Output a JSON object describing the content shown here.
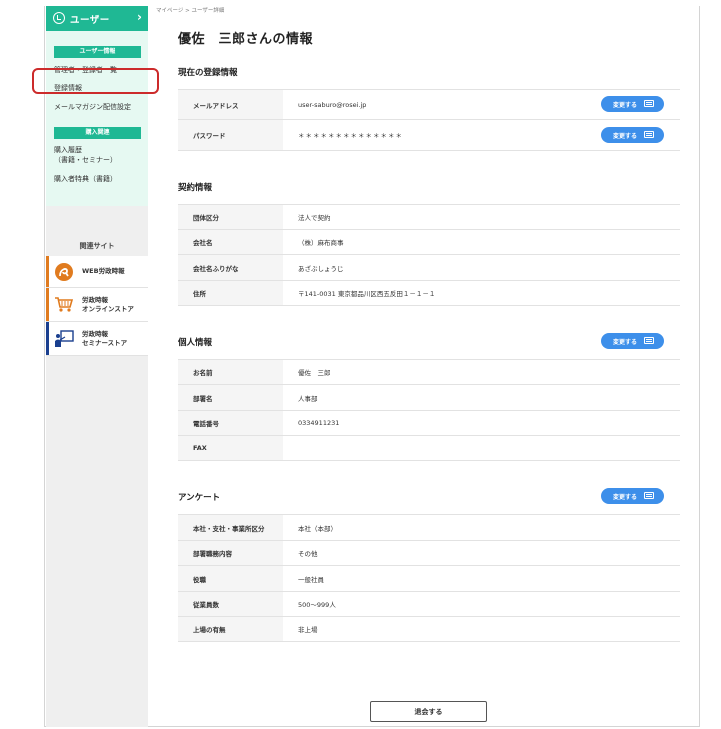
{
  "breadcrumb": "マイページ > ユーザー詳細",
  "page_title": "優佐　三郎さんの情報",
  "sidebar": {
    "header_label": "ユーザー",
    "section_user": "ユーザー情報",
    "links_user": [
      "管理者・登録者一覧",
      "登録情報",
      "メールマガジン配信設定"
    ],
    "section_purchase": "購入関連",
    "purchase_history_line1": "購入履歴",
    "purchase_history_line2": "（書籍・セミナー）",
    "purchase_benefit": "購入者特典（書籍）",
    "related_title": "関連サイト",
    "related": [
      {
        "line1": "WEB労政時報",
        "line2": ""
      },
      {
        "line1": "労政時報",
        "line2": "オンラインストア"
      },
      {
        "line1": "労政時報",
        "line2": "セミナーストア"
      }
    ]
  },
  "change_label": "変更する",
  "sections": {
    "login": {
      "title": "現在の登録情報",
      "rows": [
        {
          "k": "メールアドレス",
          "v": "user-saburo@rosei.jp"
        },
        {
          "k": "パスワード",
          "v": "＊＊＊＊＊＊＊＊＊＊＊＊＊＊"
        }
      ]
    },
    "contract": {
      "title": "契約情報",
      "rows": [
        {
          "k": "団体区分",
          "v": "法人で契約"
        },
        {
          "k": "会社名",
          "v": "（株）麻布商事"
        },
        {
          "k": "会社名ふりがな",
          "v": "あざぶしょうじ"
        },
        {
          "k": "住所",
          "v": "〒141-0031 東京都品川区西五反田１－１－１"
        }
      ]
    },
    "personal": {
      "title": "個人情報",
      "rows": [
        {
          "k": "お名前",
          "v": "優佐　三郎"
        },
        {
          "k": "部署名",
          "v": "人事部"
        },
        {
          "k": "電話番号",
          "v": "0334911231"
        },
        {
          "k": "FAX",
          "v": ""
        }
      ]
    },
    "survey": {
      "title": "アンケート",
      "rows": [
        {
          "k": "本社・支社・事業所区分",
          "v": "本社（本部）"
        },
        {
          "k": "部署職務内容",
          "v": "その他"
        },
        {
          "k": "役職",
          "v": "一般社員"
        },
        {
          "k": "従業員数",
          "v": "500〜999人"
        },
        {
          "k": "上場の有無",
          "v": "非上場"
        }
      ]
    }
  },
  "withdraw_label": "退会する",
  "colors": {
    "accent_green": "#1fb894",
    "button_blue": "#3d8fea",
    "highlight_red": "#cc2b2b"
  }
}
